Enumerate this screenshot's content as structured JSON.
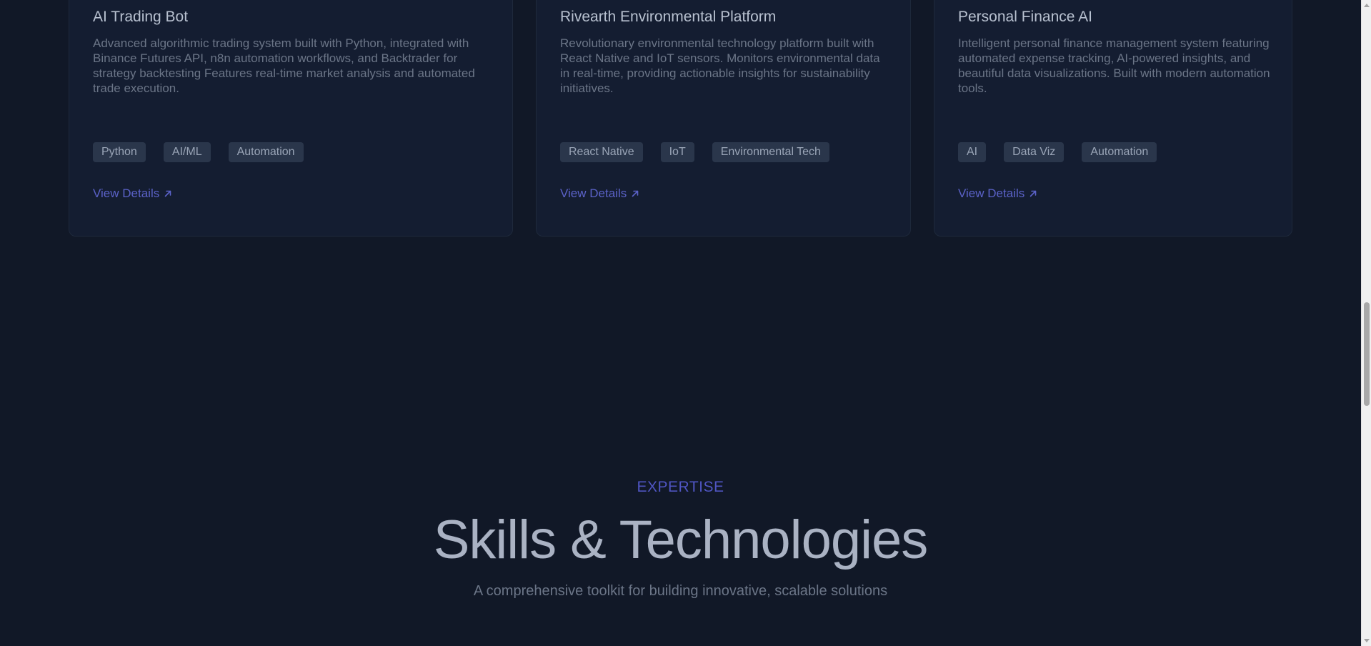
{
  "projects": [
    {
      "title": "AI Trading Bot",
      "description": "Advanced algorithmic trading system built with Python, integrated with Binance Futures API, n8n automation workflows, and Backtrader for strategy backtesting Features real-time market analysis and automated trade execution.",
      "tags": [
        "Python",
        "AI/ML",
        "Automation"
      ],
      "link_label": "View Details"
    },
    {
      "title": "Rivearth Environmental Platform",
      "description": "Revolutionary environmental technology platform built with React Native and IoT sensors. Monitors environmental data in real-time, providing actionable insights for sustainability initiatives.",
      "tags": [
        "React Native",
        "IoT",
        "Environmental Tech"
      ],
      "link_label": "View Details"
    },
    {
      "title": "Personal Finance AI",
      "description": "Intelligent personal finance management system featuring automated expense tracking, AI-powered insights, and beautiful data visualizations. Built with modern automation tools.",
      "tags": [
        "AI",
        "Data Viz",
        "Automation"
      ],
      "link_label": "View Details"
    }
  ],
  "skills_section": {
    "eyebrow": "EXPERTISE",
    "title": "Skills & Technologies",
    "subtitle": "A comprehensive toolkit for building innovative, scalable solutions"
  },
  "icons": {
    "view_details": "arrow-up-right-icon"
  },
  "colors": {
    "background": "#111827",
    "card_background": "#141d31",
    "accent": "#5b62c8",
    "tag_background": "#2a364b"
  }
}
